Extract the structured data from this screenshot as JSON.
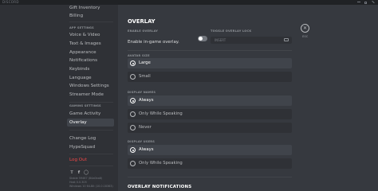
{
  "window": {
    "app_name": "DISCORD",
    "colors": {
      "accent": "#7289da",
      "danger": "#f04747",
      "bg_main": "#36393f",
      "bg_sidebar": "#2f3136"
    }
  },
  "sidebar": {
    "top_items": [
      "Gift Inventory",
      "Billing"
    ],
    "app_settings_header": "APP SETTINGS",
    "app_items": [
      "Voice & Video",
      "Text & Images",
      "Appearance",
      "Notifications",
      "Keybinds",
      "Language",
      "Windows Settings",
      "Streamer Mode"
    ],
    "gaming_header": "GAMING SETTINGS",
    "gaming_items": [
      "Game Activity",
      "Overlay"
    ],
    "other_items": [
      "Change Log",
      "HypeSquad"
    ],
    "logout": "Log Out",
    "social_icons": [
      "twitter-icon",
      "facebook-icon",
      "instagram-icon"
    ],
    "version_lines": [
      "Stable 59467 (84a0ba8)",
      "Host 0.0.305",
      "Windows 10 64-Bit (10.0.18363)"
    ]
  },
  "main": {
    "title": "OVERLAY",
    "enable_overlay_header": "ENABLE OVERLAY",
    "enable_overlay_label": "Enable in-game overlay.",
    "enable_overlay_on": false,
    "toggle_lock_header": "TOGGLE OVERLAY LOCK",
    "toggle_lock_value": "INSERT",
    "esc_label": "ESC",
    "avatar_size_header": "AVATAR SIZE",
    "avatar_size_options": [
      "Large",
      "Small"
    ],
    "display_names_header": "DISPLAY NAMES",
    "display_names_options": [
      "Always",
      "Only While Speaking",
      "Never"
    ],
    "display_users_header": "DISPLAY USERS",
    "display_users_options": [
      "Always",
      "Only While Speaking"
    ],
    "notifications_header": "OVERLAY NOTIFICATIONS"
  }
}
